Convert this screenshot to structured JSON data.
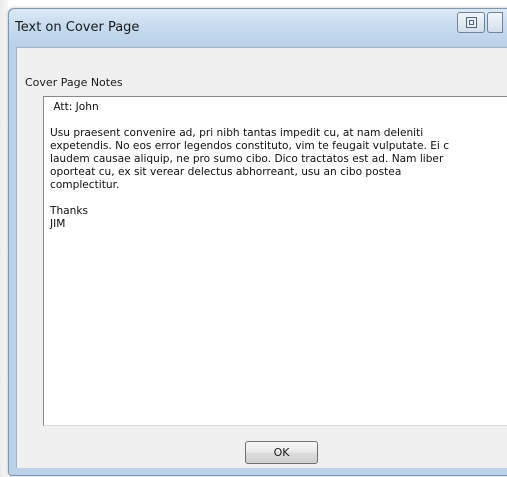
{
  "window": {
    "title": "Text on Cover Page"
  },
  "group": {
    "label": "Cover Page Notes"
  },
  "notes": {
    "text": " Att: John\n\nUsu praesent convenire ad, pri nibh tantas impedit cu, at nam deleniti\nexpetendis. No eos error legendos constituto, vim te feugait vulputate. Ei c\nlaudem causae aliquip, ne pro sumo cibo. Dico tractatos est ad. Nam liber\noporteat cu, ex sit verear delectus abhorreant, usu an cibo postea\ncomplectitur.\n\nThanks\nJIM"
  },
  "buttons": {
    "ok_label": "OK",
    "titlebar_icon": "restore-icon"
  }
}
